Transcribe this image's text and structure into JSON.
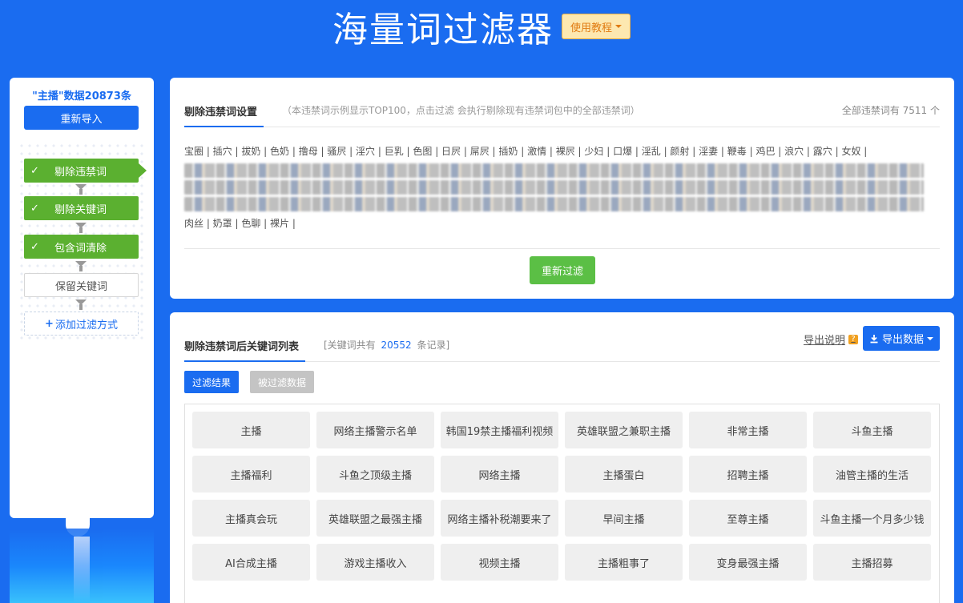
{
  "header": {
    "title": "海量词过滤器",
    "tutorial_label": "使用教程"
  },
  "sidebar": {
    "data_count": "\"主播\"数据20873条",
    "reimport_label": "重新导入",
    "steps": [
      {
        "label": "剔除违禁词",
        "status": "done"
      },
      {
        "label": "剔除关键词",
        "status": "done"
      },
      {
        "label": "包含词清除",
        "status": "done"
      },
      {
        "label": "保留关键词",
        "status": "pending"
      }
    ],
    "add_label": "添加过滤方式"
  },
  "banned_panel": {
    "tab_title": "剔除违禁词设置",
    "note": "（本违禁词示例显示TOP100，点击过滤 会执行剔除现有违禁词包中的全部违禁词）",
    "total": "全部违禁词有 7511 个",
    "first_row": "宝圈 | 插穴 | 拔奶 | 色奶 | 撸母 | 骚屄 | 淫穴 | 巨乳 | 色图 | 日屄 | 屌屄 | 插奶 | 激情 | 裸屄 | 少妇 | 口爆 | 淫乱 | 颜射 | 淫妻 | 鞭毒 | 鸡巴 | 浪穴 | 露穴 | 女奴 |",
    "last_row": "肉丝 | 奶罩 | 色聊 | 裸片 |",
    "refilter_label": "重新过滤"
  },
  "keyword_panel": {
    "tab_title": "剔除违禁词后关键词列表",
    "count_prefix": "[关键词共有",
    "count": "20552",
    "count_suffix": "条记录]",
    "export_help": "导出说明",
    "export_label": "导出数据",
    "tab_active": "过滤结果",
    "tab_inactive": "被过滤数据",
    "keywords": [
      "主播",
      "网络主播警示名单",
      "韩国19禁主播福利视频",
      "英雄联盟之兼职主播",
      "非常主播",
      "斗鱼主播",
      "主播福利",
      "斗鱼之顶级主播",
      "网络主播",
      "主播蛋白",
      "招聘主播",
      "油管主播的生活",
      "主播真会玩",
      "英雄联盟之最强主播",
      "网络主播补税潮要来了",
      "早间主播",
      "至尊主播",
      "斗鱼主播一个月多少钱",
      "AI合成主播",
      "游戏主播收入",
      "视频主播",
      "主播粗事了",
      "变身最强主播",
      "主播招募"
    ]
  }
}
